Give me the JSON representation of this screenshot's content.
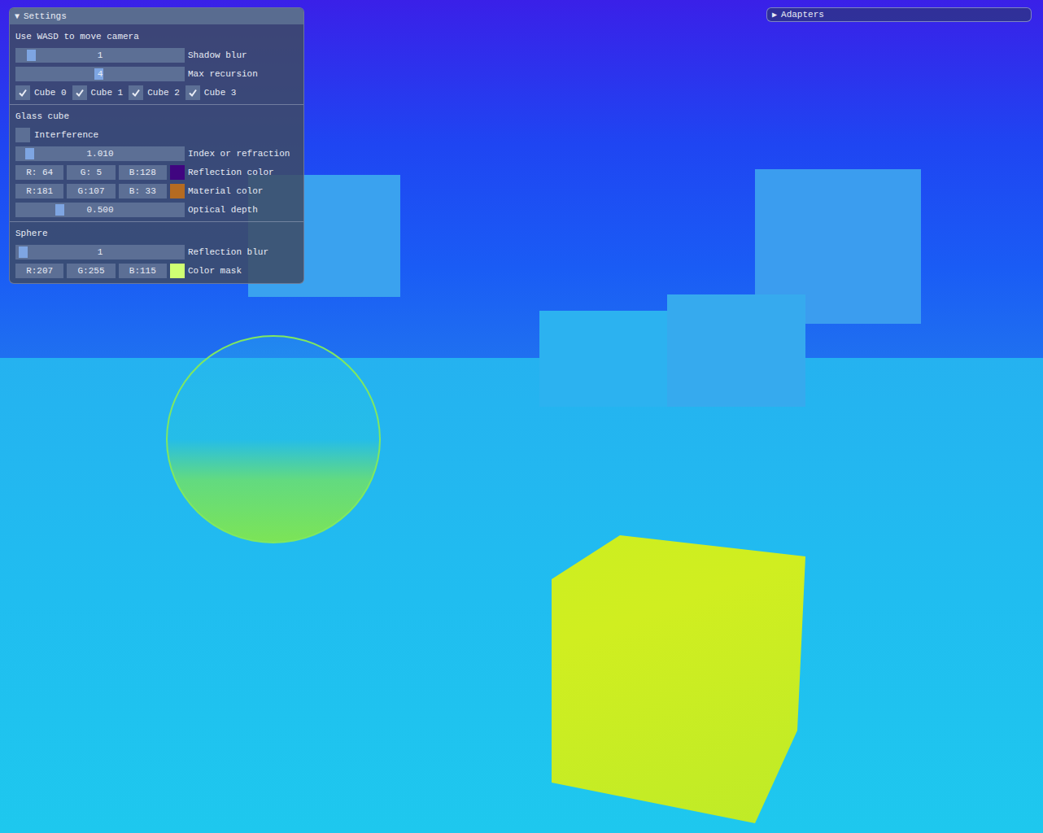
{
  "settings": {
    "toggle": "▼",
    "title": "Settings",
    "expanded": true,
    "items": [
      {
        "kind": "text",
        "text": "Use WASD to move camera"
      },
      {
        "kind": "slider",
        "value": "1",
        "label": "Shadow blur",
        "level": 0.07
      },
      {
        "kind": "slider",
        "value": "4",
        "label": "Max recursion",
        "level": 0.49
      },
      {
        "kind": "checkboxes",
        "boxes": [
          {
            "label": "Cube 0",
            "checked": true
          },
          {
            "label": "Cube 1",
            "checked": true
          },
          {
            "label": "Cube 2",
            "checked": true
          },
          {
            "label": "Cube 3",
            "checked": true
          }
        ]
      },
      {
        "kind": "section",
        "text": "Glass cube"
      },
      {
        "kind": "checkbox",
        "label": "Interference",
        "checked": false
      },
      {
        "kind": "slider",
        "value": "1.010",
        "label": "Index or refraction",
        "level": 0.06
      },
      {
        "kind": "color",
        "fields": [
          "R: 64",
          "G:  5",
          "B:128"
        ],
        "label": "Reflection color",
        "color": "#400580"
      },
      {
        "kind": "color",
        "fields": [
          "R:181",
          "G:107",
          "B: 33"
        ],
        "label": "Material color",
        "color": "#b56b21"
      },
      {
        "kind": "slider",
        "value": "0.500",
        "label": "Optical depth",
        "level": 0.25
      },
      {
        "kind": "section",
        "text": "Sphere"
      },
      {
        "kind": "slider",
        "value": "1",
        "label": "Reflection blur",
        "level": 0.02
      },
      {
        "kind": "color",
        "fields": [
          "R:207",
          "G:255",
          "B:115"
        ],
        "label": "Color mask",
        "color": "#cfff73"
      }
    ]
  },
  "adapters": {
    "toggle": "▶",
    "title": "Adapters",
    "expanded": false
  }
}
